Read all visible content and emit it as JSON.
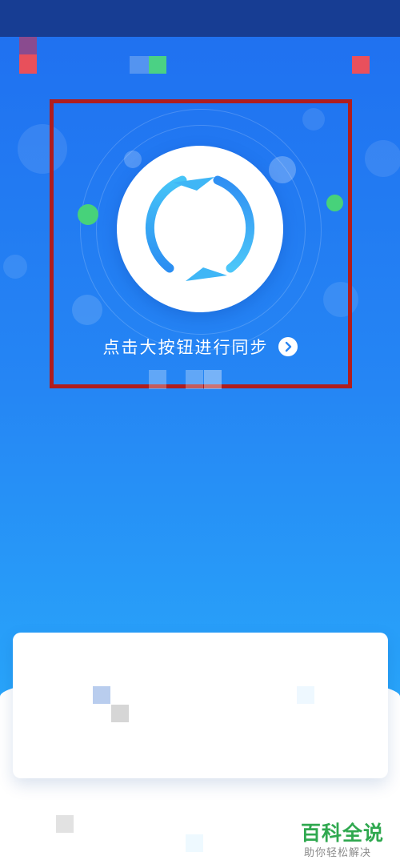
{
  "sync": {
    "caption": "点击大按钮进行同步",
    "chevron": "›"
  },
  "watermark": {
    "title": "百科全说",
    "subtitle": "助你轻松解决"
  },
  "icons": {
    "sync": "sync-arrows-icon",
    "chevron": "chevron-right-icon"
  },
  "colors": {
    "highlight_border": "#b01d1d",
    "accent_green": "#47d27a",
    "sync_arc": "#2f95f3",
    "watermark_green": "#2fa84f"
  }
}
